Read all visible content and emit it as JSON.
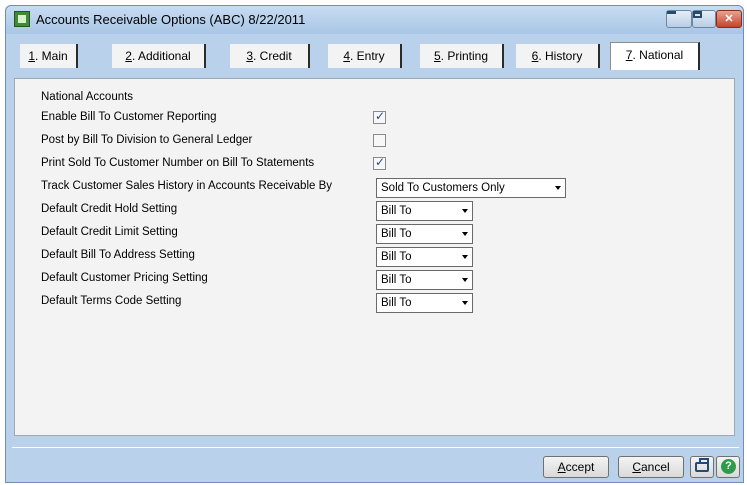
{
  "window": {
    "title": "Accounts Receivable Options (ABC) 8/22/2011"
  },
  "tabs": [
    {
      "key": "1",
      "rest": ". Main"
    },
    {
      "key": "2",
      "rest": ". Additional"
    },
    {
      "key": "3",
      "rest": ". Credit"
    },
    {
      "key": "4",
      "rest": ". Entry"
    },
    {
      "key": "5",
      "rest": ". Printing"
    },
    {
      "key": "6",
      "rest": ". History"
    },
    {
      "key": "7",
      "rest": ". National"
    }
  ],
  "active_tab": "7. National",
  "section": {
    "heading": "National Accounts"
  },
  "fields": {
    "enable_bill_to": {
      "label": "Enable Bill To Customer Reporting",
      "checked": true
    },
    "post_by_division": {
      "label": "Post by Bill To Division to General Ledger",
      "checked": false
    },
    "print_sold_to": {
      "label": "Print Sold To Customer Number on Bill To Statements",
      "checked": true
    },
    "track_history": {
      "label": "Track Customer Sales History in Accounts Receivable By",
      "value": "Sold To Customers Only"
    },
    "credit_hold": {
      "label": "Default Credit Hold Setting",
      "value": "Bill To"
    },
    "credit_limit": {
      "label": "Default Credit Limit Setting",
      "value": "Bill To"
    },
    "bill_to_address": {
      "label": "Default Bill To Address Setting",
      "value": "Bill To"
    },
    "customer_pricing": {
      "label": "Default Customer Pricing Setting",
      "value": "Bill To"
    },
    "terms_code": {
      "label": "Default Terms Code Setting",
      "value": "Bill To"
    }
  },
  "buttons": {
    "accept": {
      "key": "A",
      "rest": "ccept"
    },
    "cancel": {
      "key": "C",
      "rest": "ancel"
    }
  },
  "icons": {
    "app": "app-icon",
    "minimize": "minimize-icon",
    "maximize": "maximize-icon",
    "close": "close-icon",
    "print": "printer-icon",
    "help": "help-icon"
  },
  "colors": {
    "window_bg": "#b9d1ea",
    "panel_bg": "#f3f3f3",
    "close_btn": "#c4442c",
    "help_green": "#2e9b4a"
  }
}
